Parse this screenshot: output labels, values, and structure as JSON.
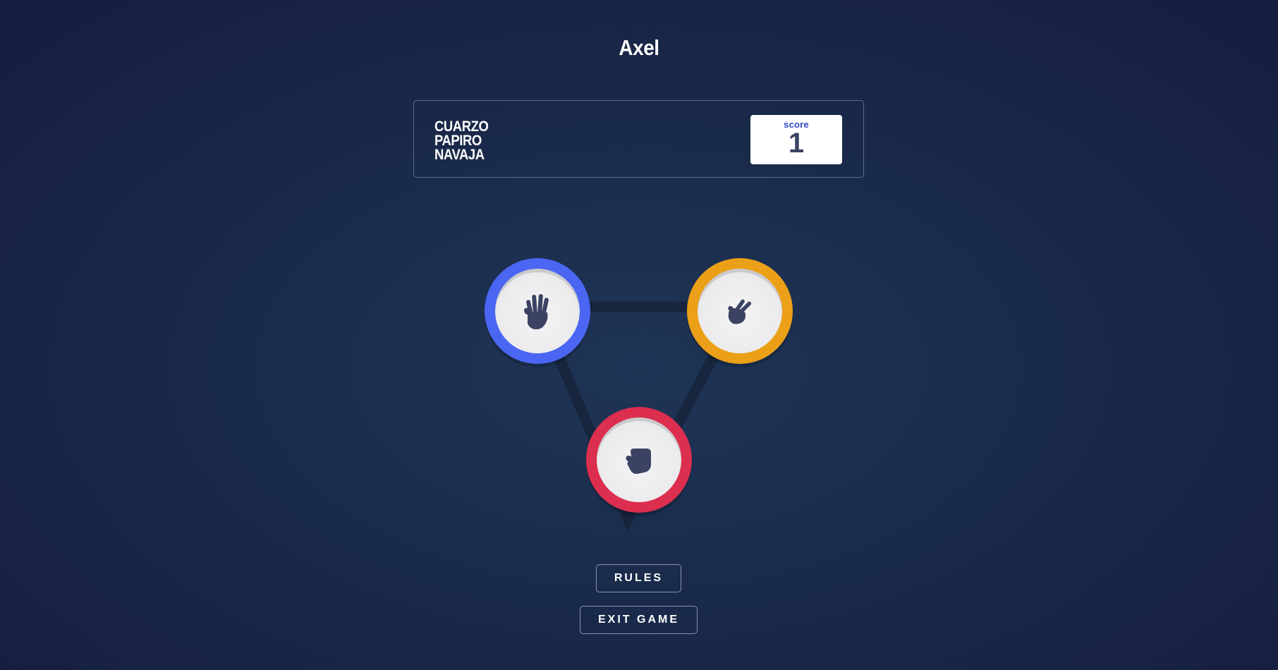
{
  "player": {
    "name": "Axel"
  },
  "header": {
    "title_lines": [
      "CUARZO",
      "PAPIRO",
      "NAVAJA"
    ],
    "score_label": "score",
    "score_value": "1"
  },
  "board": {
    "choices": [
      {
        "id": "paper",
        "icon": "hand-paper-icon",
        "ring_color": "#4a66f2"
      },
      {
        "id": "scissors",
        "icon": "hand-scissors-icon",
        "ring_color": "#eca018"
      },
      {
        "id": "rock",
        "icon": "hand-rock-icon",
        "ring_color": "#dc2e4f"
      }
    ]
  },
  "buttons": {
    "rules_label": "RULES",
    "exit_label": "EXIT GAME"
  }
}
